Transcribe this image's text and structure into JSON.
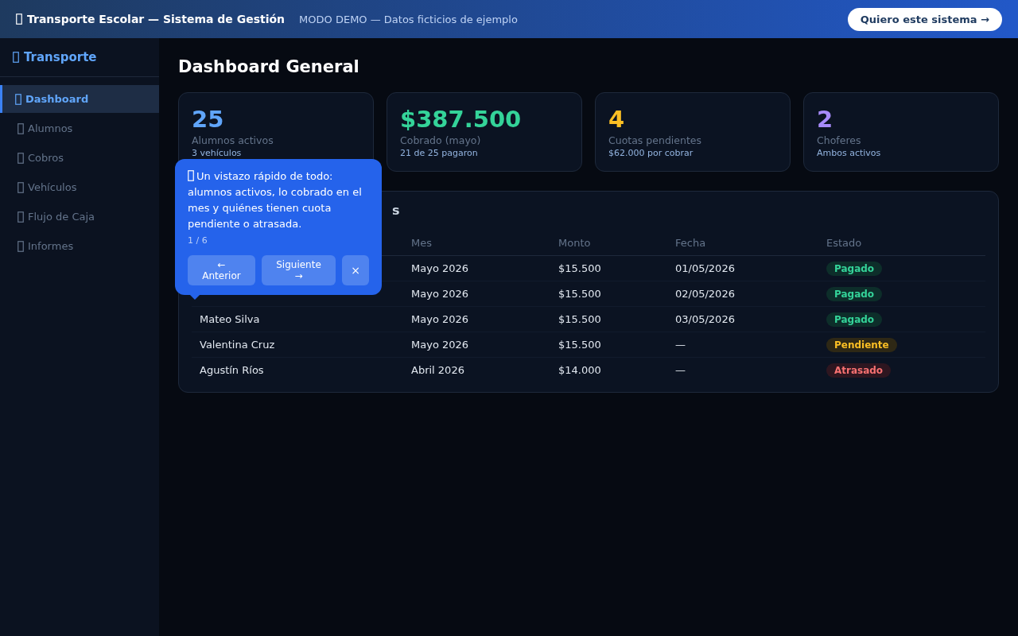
{
  "top_bar": {
    "title": "Transporte Escolar — Sistema de Gestión",
    "subtitle": "MODO DEMO — Datos ficticios de ejemplo",
    "cta": "Quiero este sistema →"
  },
  "sidebar": {
    "brand": "Transporte",
    "items": [
      {
        "label": "Dashboard",
        "selected": true
      },
      {
        "label": "Alumnos",
        "selected": false
      },
      {
        "label": "Cobros",
        "selected": false
      },
      {
        "label": "Vehículos",
        "selected": false
      },
      {
        "label": "Flujo de Caja",
        "selected": false
      },
      {
        "label": "Informes",
        "selected": false
      }
    ]
  },
  "page_title": "Dashboard General",
  "stats": [
    {
      "value": "25",
      "label": "Alumnos activos",
      "sub": "3 vehículos",
      "color": "#60a5fa"
    },
    {
      "value": "$387.500",
      "label": "Cobrado (mayo)",
      "sub": "21 de 25 pagaron",
      "color": "#34d399"
    },
    {
      "value": "4",
      "label": "Cuotas pendientes",
      "sub": "$62.000 por cobrar",
      "color": "#fbbf24"
    },
    {
      "value": "2",
      "label": "Choferes",
      "sub": "Ambos activos",
      "color": "#a78bfa"
    }
  ],
  "table": {
    "title_visible": "s",
    "columns": [
      "Mes",
      "Monto",
      "Fecha",
      "Estado"
    ],
    "rows": [
      {
        "mes": "Mayo 2026",
        "monto": "$15.500",
        "fecha": "01/05/2026",
        "estado": "Pagado",
        "kind": "paid"
      },
      {
        "mes": "Mayo 2026",
        "monto": "$15.500",
        "fecha": "02/05/2026",
        "estado": "Pagado",
        "kind": "paid"
      },
      {
        "name": "Mateo Silva",
        "mes": "Mayo 2026",
        "monto": "$15.500",
        "fecha": "03/05/2026",
        "estado": "Pagado",
        "kind": "paid"
      },
      {
        "name": "Valentina Cruz",
        "mes": "Mayo 2026",
        "monto": "$15.500",
        "fecha": "—",
        "estado": "Pendiente",
        "kind": "pending"
      },
      {
        "name": "Agustín Ríos",
        "mes": "Abril 2026",
        "monto": "$14.000",
        "fecha": "—",
        "estado": "Atrasado",
        "kind": "late"
      }
    ]
  },
  "tour": {
    "text": "Un vistazo rápido de todo: alumnos activos, lo cobrado en el mes y quiénes tienen cuota pendiente o atrasada.",
    "step": "1 / 6",
    "prev": "← Anterior",
    "next": "Siguiente →",
    "close": "×"
  }
}
